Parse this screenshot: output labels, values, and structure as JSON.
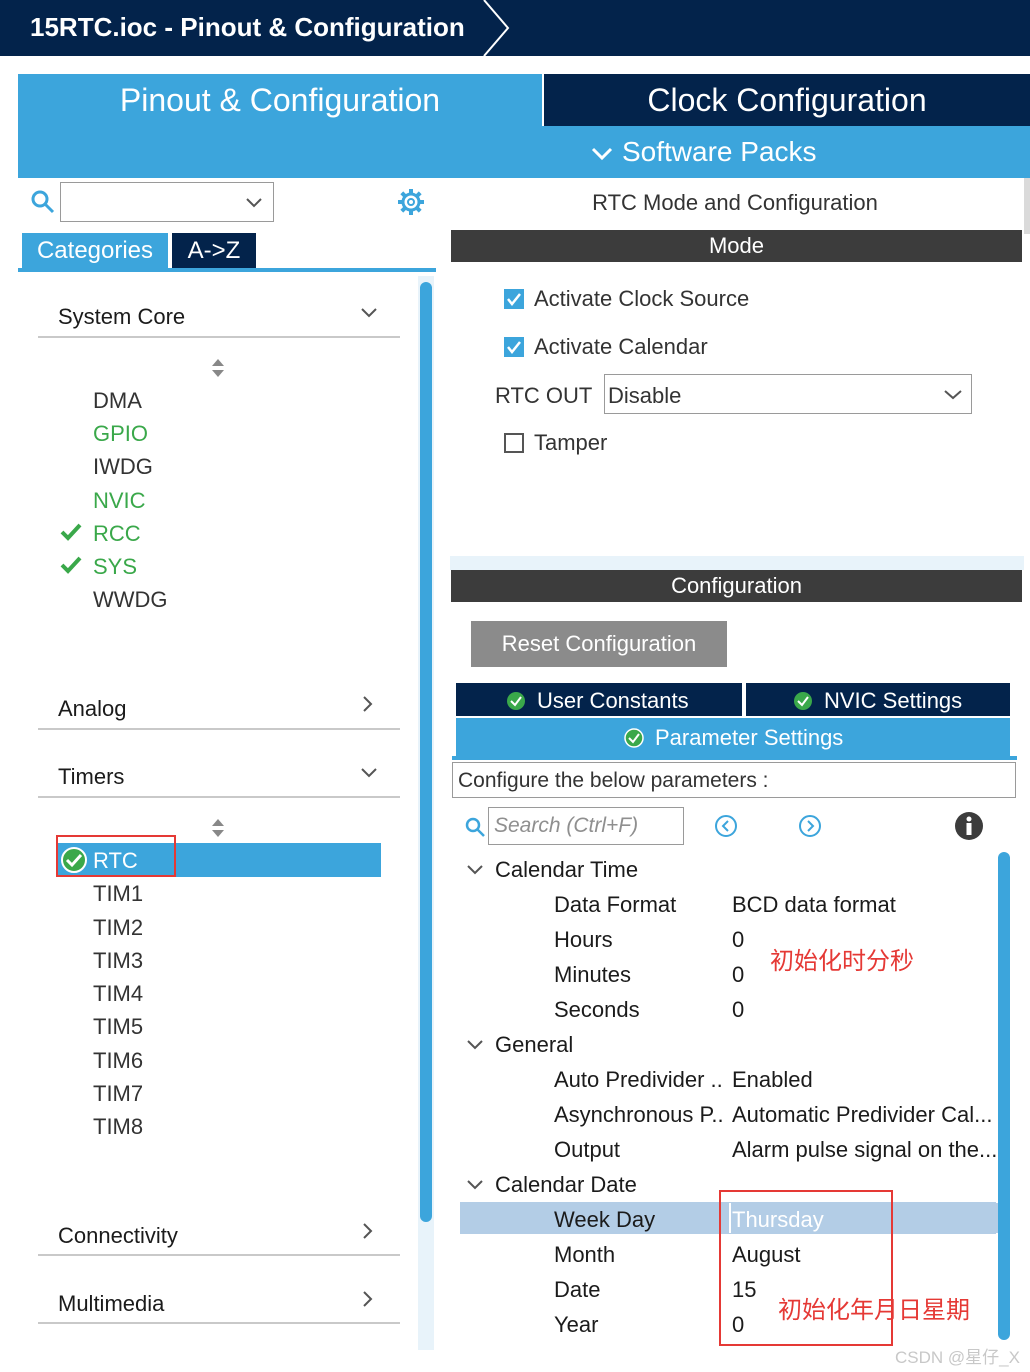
{
  "title_bar": {
    "title": "15RTC.ioc - Pinout & Configuration"
  },
  "top_tabs": {
    "pinout": "Pinout & Configuration",
    "clock": "Clock Configuration",
    "software_packs": "Software Packs"
  },
  "left": {
    "tabs": {
      "categories": "Categories",
      "az": "A->Z"
    },
    "categories": {
      "system_core": "System Core",
      "analog": "Analog",
      "timers": "Timers",
      "connectivity": "Connectivity",
      "multimedia": "Multimedia"
    },
    "system_core_items": [
      "DMA",
      "GPIO",
      "IWDG",
      "NVIC",
      "RCC",
      "SYS",
      "WWDG"
    ],
    "timer_items": [
      "RTC",
      "TIM1",
      "TIM2",
      "TIM3",
      "TIM4",
      "TIM5",
      "TIM6",
      "TIM7",
      "TIM8"
    ]
  },
  "mode": {
    "panel_title": "RTC Mode and Configuration",
    "header": "Mode",
    "activate_clock_source": "Activate Clock Source",
    "activate_calendar": "Activate Calendar",
    "rtc_out_label": "RTC OUT",
    "rtc_out_value": "Disable",
    "tamper": "Tamper"
  },
  "config": {
    "header": "Configuration",
    "reset_button": "Reset Configuration",
    "tab_user_constants": "User Constants",
    "tab_nvic": "NVIC Settings",
    "tab_parameters": "Parameter Settings",
    "configure_text": "Configure the below parameters :",
    "search_placeholder": "Search (Ctrl+F)"
  },
  "params": {
    "calendar_time": {
      "title": "Calendar Time",
      "rows": [
        {
          "name": "Data Format",
          "value": "BCD data format"
        },
        {
          "name": "Hours",
          "value": "0"
        },
        {
          "name": "Minutes",
          "value": "0"
        },
        {
          "name": "Seconds",
          "value": "0"
        }
      ]
    },
    "general": {
      "title": "General",
      "rows": [
        {
          "name": "Auto Predivider ..",
          "value": "Enabled"
        },
        {
          "name": "Asynchronous P..",
          "value": "Automatic Predivider Cal..."
        },
        {
          "name": "Output",
          "value": "Alarm pulse signal on the..."
        }
      ]
    },
    "calendar_date": {
      "title": "Calendar Date",
      "rows": [
        {
          "name": "Week Day",
          "value": "Thursday"
        },
        {
          "name": "Month",
          "value": "August"
        },
        {
          "name": "Date",
          "value": "15"
        },
        {
          "name": "Year",
          "value": "0"
        }
      ]
    }
  },
  "annotations": {
    "time_note": "初始化时分秒",
    "date_note": "初始化年月日星期"
  },
  "watermark": "CSDN @星仔_X",
  "colors": {
    "navy": "#03234b",
    "accent_blue": "#3ca5dc",
    "green": "#3aa84a",
    "red": "#e53935"
  }
}
